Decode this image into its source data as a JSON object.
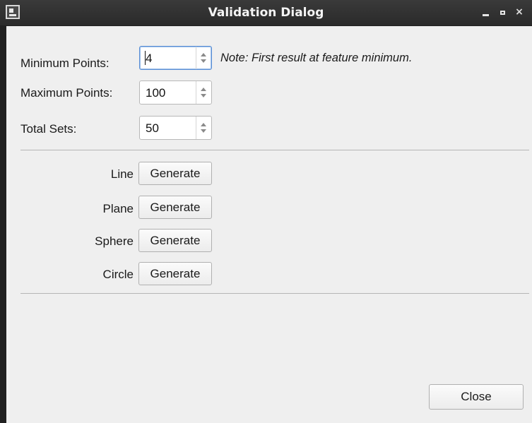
{
  "window": {
    "title": "Validation Dialog"
  },
  "fields": [
    {
      "label": "Minimum Points:",
      "value": "4"
    },
    {
      "label": "Maximum Points:",
      "value": "100"
    },
    {
      "label": "Total Sets:",
      "value": "50"
    }
  ],
  "note": "Note: First result at feature minimum.",
  "generators": [
    {
      "label": "Line",
      "button": "Generate"
    },
    {
      "label": "Plane",
      "button": "Generate"
    },
    {
      "label": "Sphere",
      "button": "Generate"
    },
    {
      "label": "Circle",
      "button": "Generate"
    }
  ],
  "footer": {
    "close_label": "Close"
  }
}
